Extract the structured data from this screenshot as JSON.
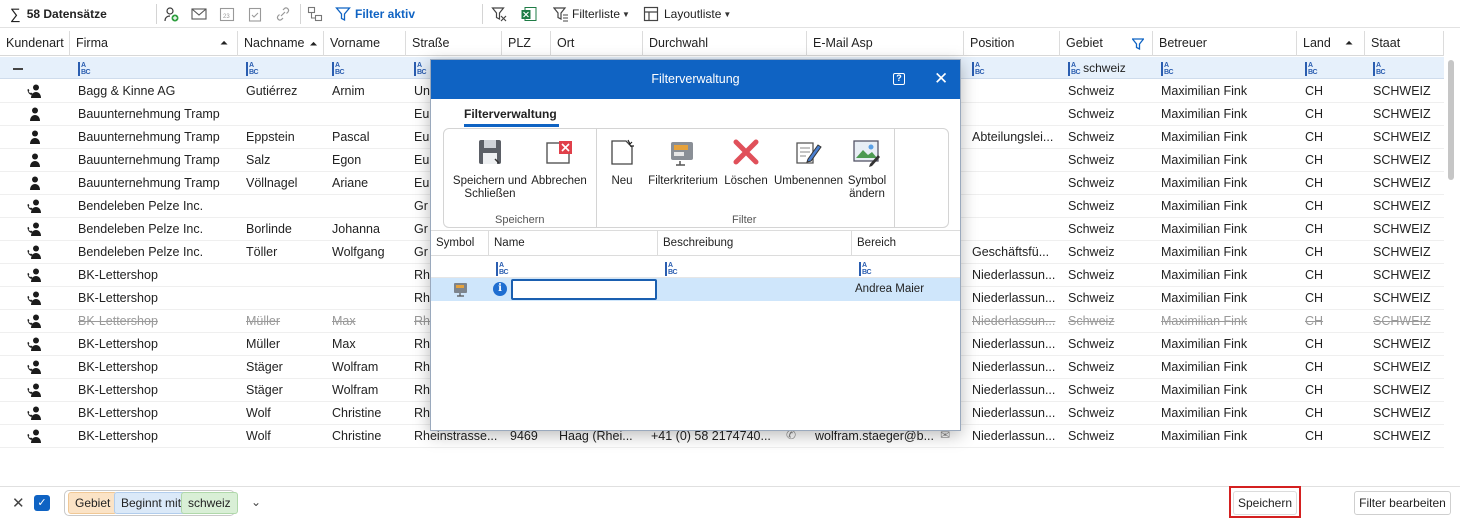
{
  "toolbar": {
    "record_count": "58 Datensätze",
    "filter_active": "Filter aktiv",
    "filterliste": "Filterliste",
    "layoutliste": "Layoutliste"
  },
  "grid": {
    "columns": [
      "Kundenart",
      "Firma",
      "Nachname",
      "Vorname",
      "Straße",
      "PLZ",
      "Ort",
      "Durchwahl",
      "E-Mail Asp",
      "Position",
      "Gebiet",
      "Betreuer",
      "Land",
      "Staat"
    ],
    "filter_gebiet": "schweiz",
    "rows": [
      {
        "firma": "Bagg & Kinne AG",
        "nachname": "Gutiérrez",
        "vorname": "Arnim",
        "strasse": "Un",
        "position": "",
        "gebiet": "Schweiz",
        "betreuer": "Maximilian Fink",
        "land": "CH",
        "staat": "SCHWEIZ",
        "icon": "phone-person",
        "strike": false
      },
      {
        "firma": "Bauunternehmung Tramp",
        "nachname": "",
        "vorname": "",
        "strasse": "Eu",
        "position": "",
        "gebiet": "Schweiz",
        "betreuer": "Maximilian Fink",
        "land": "CH",
        "staat": "SCHWEIZ",
        "icon": "person",
        "strike": false
      },
      {
        "firma": "Bauunternehmung Tramp",
        "nachname": "Eppstein",
        "vorname": "Pascal",
        "strasse": "Eu",
        "position": "Abteilungslei...",
        "gebiet": "Schweiz",
        "betreuer": "Maximilian Fink",
        "land": "CH",
        "staat": "SCHWEIZ",
        "icon": "person",
        "strike": false
      },
      {
        "firma": "Bauunternehmung Tramp",
        "nachname": "Salz",
        "vorname": "Egon",
        "strasse": "Eu",
        "position": "",
        "gebiet": "Schweiz",
        "betreuer": "Maximilian Fink",
        "land": "CH",
        "staat": "SCHWEIZ",
        "icon": "person",
        "strike": false
      },
      {
        "firma": "Bauunternehmung Tramp",
        "nachname": "Völlnagel",
        "vorname": "Ariane",
        "strasse": "Eu",
        "position": "",
        "gebiet": "Schweiz",
        "betreuer": "Maximilian Fink",
        "land": "CH",
        "staat": "SCHWEIZ",
        "icon": "person",
        "strike": false
      },
      {
        "firma": "Bendeleben Pelze Inc.",
        "nachname": "",
        "vorname": "",
        "strasse": "Gr",
        "position": "",
        "gebiet": "Schweiz",
        "betreuer": "Maximilian Fink",
        "land": "CH",
        "staat": "SCHWEIZ",
        "icon": "phone-person",
        "strike": false
      },
      {
        "firma": "Bendeleben Pelze Inc.",
        "nachname": "Borlinde",
        "vorname": "Johanna",
        "strasse": "Gr",
        "position": "",
        "gebiet": "Schweiz",
        "betreuer": "Maximilian Fink",
        "land": "CH",
        "staat": "SCHWEIZ",
        "icon": "phone-person",
        "strike": false
      },
      {
        "firma": "Bendeleben Pelze Inc.",
        "nachname": "Töller",
        "vorname": "Wolfgang",
        "strasse": "Gr",
        "position": "Geschäftsfü...",
        "gebiet": "Schweiz",
        "betreuer": "Maximilian Fink",
        "land": "CH",
        "staat": "SCHWEIZ",
        "icon": "phone-person",
        "strike": false
      },
      {
        "firma": "BK-Lettershop",
        "nachname": "",
        "vorname": "",
        "strasse": "Rh",
        "position": "Niederlassun...",
        "gebiet": "Schweiz",
        "betreuer": "Maximilian Fink",
        "land": "CH",
        "staat": "SCHWEIZ",
        "icon": "phone-person",
        "strike": false
      },
      {
        "firma": "BK-Lettershop",
        "nachname": "",
        "vorname": "",
        "strasse": "Rh",
        "position": "Niederlassun...",
        "gebiet": "Schweiz",
        "betreuer": "Maximilian Fink",
        "land": "CH",
        "staat": "SCHWEIZ",
        "icon": "phone-person",
        "strike": false
      },
      {
        "firma": "BK-Lettershop",
        "nachname": "Müller",
        "vorname": "Max",
        "strasse": "Rh",
        "position": "Niederlassun...",
        "gebiet": "Schweiz",
        "betreuer": "Maximilian Fink",
        "land": "CH",
        "staat": "SCHWEIZ",
        "icon": "phone-person",
        "strike": true
      },
      {
        "firma": "BK-Lettershop",
        "nachname": "Müller",
        "vorname": "Max",
        "strasse": "Rh",
        "position": "Niederlassun...",
        "gebiet": "Schweiz",
        "betreuer": "Maximilian Fink",
        "land": "CH",
        "staat": "SCHWEIZ",
        "icon": "phone-person",
        "strike": false
      },
      {
        "firma": "BK-Lettershop",
        "nachname": "Stäger",
        "vorname": "Wolfram",
        "strasse": "Rh",
        "position": "Niederlassun...",
        "gebiet": "Schweiz",
        "betreuer": "Maximilian Fink",
        "land": "CH",
        "staat": "SCHWEIZ",
        "icon": "phone-person",
        "strike": false
      },
      {
        "firma": "BK-Lettershop",
        "nachname": "Stäger",
        "vorname": "Wolfram",
        "strasse": "Rh",
        "position": "Niederlassun...",
        "gebiet": "Schweiz",
        "betreuer": "Maximilian Fink",
        "land": "CH",
        "staat": "SCHWEIZ",
        "icon": "phone-person",
        "strike": false
      },
      {
        "firma": "BK-Lettershop",
        "nachname": "Wolf",
        "vorname": "Christine",
        "strasse": "Rh",
        "position": "Niederlassun...",
        "gebiet": "Schweiz",
        "betreuer": "Maximilian Fink",
        "land": "CH",
        "staat": "SCHWEIZ",
        "icon": "phone-person",
        "strike": false
      },
      {
        "firma": "BK-Lettershop",
        "nachname": "Wolf",
        "vorname": "Christine",
        "strasse": "Rheinstrasse...",
        "plz": "9469",
        "ort": "Haag (Rhei...",
        "durchwahl": "+41 (0) 58 2174740...",
        "email": "wolfram.staeger@b...",
        "position": "Niederlassun...",
        "gebiet": "Schweiz",
        "betreuer": "Maximilian Fink",
        "land": "CH",
        "staat": "SCHWEIZ",
        "icon": "phone-person",
        "strike": false
      }
    ]
  },
  "dialog": {
    "title": "Filterverwaltung",
    "tab": "Filterverwaltung",
    "buttons": {
      "save_close": "Speichern und Schließen",
      "cancel": "Abbrechen",
      "new": "Neu",
      "criteria": "Filterkriterium",
      "delete": "Löschen",
      "rename": "Umbenennen",
      "change_symbol": "Symbol ändern"
    },
    "groups": {
      "save": "Speichern",
      "filter": "Filter"
    },
    "columns": [
      "Symbol",
      "Name",
      "Beschreibung",
      "Bereich"
    ],
    "row": {
      "name": "",
      "beschreibung": "",
      "bereich": "Andrea Maier"
    }
  },
  "bottom": {
    "chips": [
      "Gebiet",
      "Beginnt mit",
      "schweiz"
    ],
    "save_button": "Speichern",
    "edit_filter_button": "Filter bearbeiten"
  },
  "colors": {
    "accent": "#0f63c3",
    "highlight": "#d42020",
    "filter_row": "#e6f0fb"
  }
}
